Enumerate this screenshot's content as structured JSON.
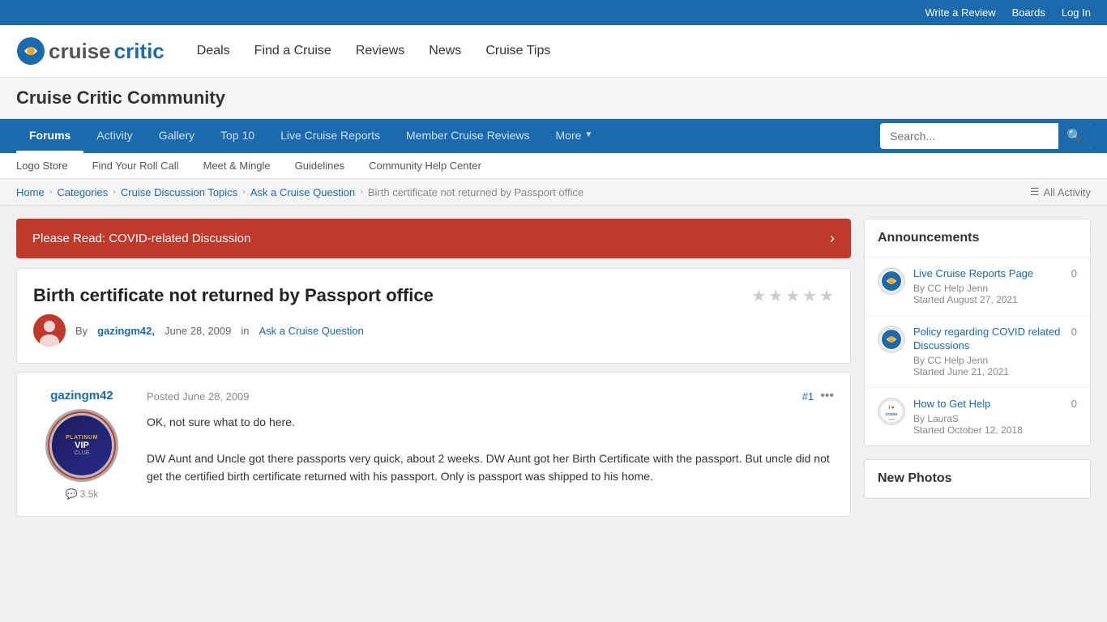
{
  "topbar": {
    "write_review": "Write a Review",
    "boards": "Boards",
    "log_in": "Log In"
  },
  "header": {
    "logo_text_cruise": "cruise",
    "logo_text_critic": "critic",
    "nav": {
      "deals": "Deals",
      "find_a_cruise": "Find a Cruise",
      "reviews": "Reviews",
      "news": "News",
      "cruise_tips": "Cruise Tips"
    }
  },
  "community": {
    "title": "Cruise Critic Community"
  },
  "forums_nav": {
    "items": [
      {
        "id": "forums",
        "label": "Forums",
        "active": true
      },
      {
        "id": "activity",
        "label": "Activity",
        "active": false
      },
      {
        "id": "gallery",
        "label": "Gallery",
        "active": false
      },
      {
        "id": "top10",
        "label": "Top 10",
        "active": false
      },
      {
        "id": "live-cruise-reports",
        "label": "Live Cruise Reports",
        "active": false
      },
      {
        "id": "member-cruise-reviews",
        "label": "Member Cruise Reviews",
        "active": false
      },
      {
        "id": "more",
        "label": "More",
        "active": false
      }
    ],
    "search_placeholder": "Search..."
  },
  "sub_nav": {
    "items": [
      {
        "id": "logo-store",
        "label": "Logo Store"
      },
      {
        "id": "find-your-roll-call",
        "label": "Find Your Roll Call"
      },
      {
        "id": "meet-mingle",
        "label": "Meet & Mingle"
      },
      {
        "id": "guidelines",
        "label": "Guidelines"
      },
      {
        "id": "community-help-center",
        "label": "Community Help Center"
      }
    ]
  },
  "breadcrumb": {
    "items": [
      {
        "id": "home",
        "label": "Home"
      },
      {
        "id": "categories",
        "label": "Categories"
      },
      {
        "id": "cruise-discussion-topics",
        "label": "Cruise Discussion Topics"
      },
      {
        "id": "ask-a-cruise-question",
        "label": "Ask a Cruise Question"
      }
    ],
    "current": "Birth certificate not returned by Passport office",
    "all_activity": "All Activity"
  },
  "covid_banner": {
    "text": "Please Read: COVID-related Discussion",
    "arrow": "›"
  },
  "topic": {
    "title": "Birth certificate not returned by Passport office",
    "author": "gazingm42,",
    "date": "June 28, 2009",
    "forum": "Ask a Cruise Question",
    "by_label": "By",
    "in_label": "in",
    "stars": [
      "★",
      "★",
      "★",
      "★",
      "★"
    ]
  },
  "post": {
    "author_name": "gazingm42",
    "posted_label": "Posted",
    "date": "June 28, 2009",
    "number": "#1",
    "comments": "3.5k",
    "text_1": "OK, not sure what to do here.",
    "text_2": "DW Aunt and Uncle got there passports very quick, about 2 weeks. DW Aunt got her Birth Certificate with the passport. But uncle did not get the certified birth certificate returned with his passport. Only is passport was shipped to his home."
  },
  "announcements": {
    "title": "Announcements",
    "items": [
      {
        "id": "live-cruise-reports",
        "title": "Live Cruise Reports Page",
        "by": "By CC Help Jenn",
        "started": "Started August 27, 2021",
        "count": "0",
        "icon_type": "cc"
      },
      {
        "id": "policy-covid",
        "title": "Policy regarding COVID related Discussions",
        "by": "By CC Help Jenn",
        "started": "Started June 21, 2021",
        "count": "0",
        "icon_type": "cc"
      },
      {
        "id": "how-to-get-help",
        "title": "How to Get Help",
        "by": "By LauraS",
        "started": "Started October 12, 2018",
        "count": "0",
        "icon_type": "ilove"
      }
    ]
  },
  "new_photos": {
    "title": "New Photos"
  }
}
